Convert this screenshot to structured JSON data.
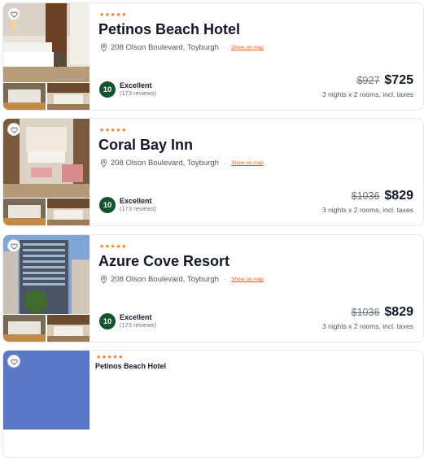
{
  "listings": [
    {
      "stars": "★★★★★",
      "name": "Petinos Beach Hotel",
      "address": "208 Olson Boulevard, Toyburgh",
      "map_link": "Show on map",
      "score": "10",
      "rating_label": "Excellent",
      "reviews": "(173 reviews)",
      "old_price": "$927",
      "price": "$725",
      "stay_info": "3 nights x 2 rooms, incl. taxes"
    },
    {
      "stars": "★★★★★",
      "name": "Coral Bay Inn",
      "address": "208 Olson Boulevard, Toyburgh",
      "map_link": "Show on map",
      "score": "10",
      "rating_label": "Excellent",
      "reviews": "(173 reviews)",
      "old_price": "$1036",
      "price": "$829",
      "stay_info": "3 nights x 2 rooms, incl. taxes"
    },
    {
      "stars": "★★★★★",
      "name": "Azure Cove Resort",
      "address": "208 Olson Boulevard, Toyburgh",
      "map_link": "Show on map",
      "score": "10",
      "rating_label": "Excellent",
      "reviews": "(173 reviews)",
      "old_price": "$1036",
      "price": "$829",
      "stay_info": "3 nights x 2 rooms, incl. taxes"
    },
    {
      "stars": "★★★★★",
      "name": "Petinos Beach Hotel"
    }
  ],
  "icons": {
    "favorite": "heart-icon",
    "location": "location-pin-icon"
  },
  "colors": {
    "accent": "#f97316",
    "score_badge": "#14532d"
  }
}
